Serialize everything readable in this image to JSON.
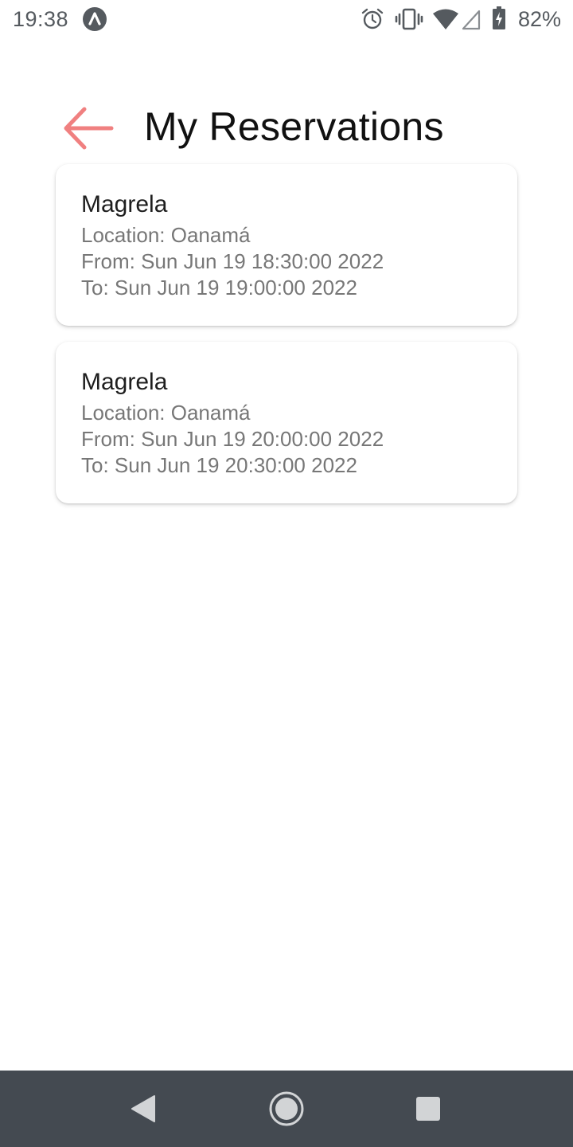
{
  "status_bar": {
    "time": "19:38",
    "battery_percent": "82%",
    "icons": [
      "app-notification-icon",
      "alarm-icon",
      "vibrate-icon",
      "wifi-icon",
      "cell-signal-icon",
      "battery-charging-icon"
    ]
  },
  "header": {
    "title": "My Reservations",
    "back_icon": "arrow-left-icon",
    "accent_color": "#f08080"
  },
  "reservations": [
    {
      "name": "Magrela",
      "location": "Location: Oanamá",
      "from": "From: Sun Jun 19 18:30:00 2022",
      "to": "To: Sun Jun 19 19:00:00 2022"
    },
    {
      "name": "Magrela",
      "location": "Location: Oanamá",
      "from": "From: Sun Jun 19 20:00:00 2022",
      "to": "To: Sun Jun 19 20:30:00 2022"
    }
  ],
  "nav_bar": {
    "buttons": [
      "nav-back-icon",
      "nav-home-icon",
      "nav-recents-icon"
    ],
    "background_color": "#444a51"
  }
}
